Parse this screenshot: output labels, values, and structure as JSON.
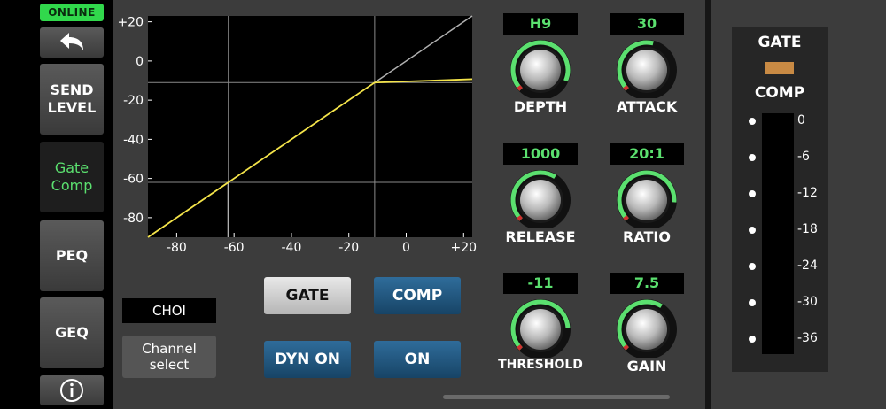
{
  "nav": {
    "status": "ONLINE",
    "items": [
      {
        "label": "SEND\nLEVEL",
        "line1": "SEND",
        "line2": "LEVEL"
      },
      {
        "label": "Gate Comp",
        "line1": "Gate",
        "line2": "Comp"
      },
      {
        "label": "PEQ"
      },
      {
        "label": "GEQ"
      }
    ],
    "back_icon": "back-arrow-icon",
    "info_icon": "info-icon"
  },
  "graph": {
    "y_ticks": [
      "+20",
      "0",
      "-20",
      "-40",
      "-60",
      "-80"
    ],
    "x_ticks": [
      "-80",
      "-60",
      "-40",
      "-20",
      "0",
      "+20"
    ],
    "threshold_db": -11,
    "ratio": 20,
    "gate_db": -62,
    "colors": {
      "curve": "#f4e44a",
      "reference": "#b0b0b0",
      "grid": "#8a8a8a"
    }
  },
  "channel": {
    "name": "CHOI",
    "select_label_1": "Channel",
    "select_label_2": "select"
  },
  "buttons": {
    "gate": "GATE",
    "comp": "COMP",
    "dyn_on": "DYN ON",
    "on": "ON"
  },
  "knobs": [
    {
      "key": "depth",
      "value": "H9",
      "label": "DEPTH",
      "level": 0.92
    },
    {
      "key": "attack",
      "value": "30",
      "label": "ATTACK",
      "level": 0.55
    },
    {
      "key": "release",
      "value": "1000",
      "label": "RELEASE",
      "level": 0.62
    },
    {
      "key": "ratio",
      "value": "20:1",
      "label": "RATIO",
      "level": 0.85
    },
    {
      "key": "threshold",
      "value": "-11",
      "label": "THRESHOLD",
      "level": 0.82
    },
    {
      "key": "gain",
      "value": "7.5",
      "label": "GAIN",
      "level": 0.62
    }
  ],
  "meter": {
    "gate_label": "GATE",
    "comp_label": "COMP",
    "ticks": [
      "0",
      "-6",
      "-12",
      "-18",
      "-24",
      "-30",
      "-36"
    ],
    "gate_color": "#c88a44"
  },
  "colors": {
    "accent_green": "#5be06f",
    "online_green": "#31d84c"
  }
}
